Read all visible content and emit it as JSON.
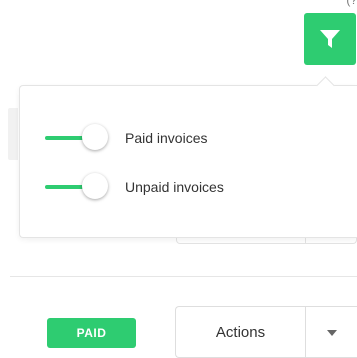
{
  "colors": {
    "accent": "#2ecc71",
    "border": "#e4e4e4",
    "text": "#333333"
  },
  "toolbar": {
    "filter_icon": "filter-icon",
    "top_fragment": "(?"
  },
  "filter_popover": {
    "toggles": [
      {
        "label": "Paid invoices",
        "on": true
      },
      {
        "label": "Unpaid invoices",
        "on": true
      }
    ]
  },
  "row": {
    "status_badge": "PAID",
    "actions_label": "Actions",
    "caret_icon": "caret-down-icon"
  }
}
